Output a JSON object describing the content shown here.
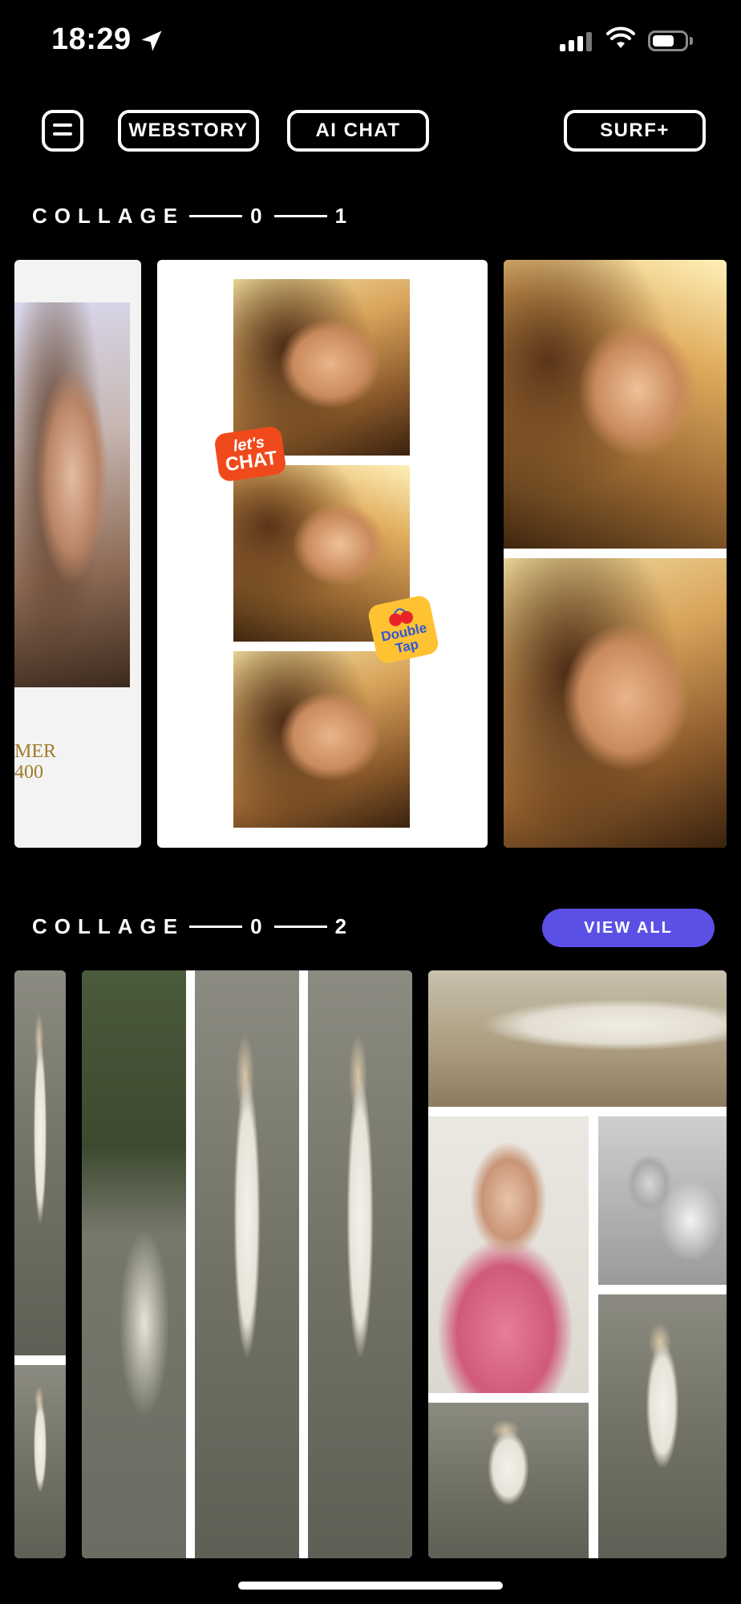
{
  "status_bar": {
    "time": "18:29"
  },
  "nav": {
    "menu_icon": "menu-icon",
    "webstory": "WEBSTORY",
    "ai_chat": "AI CHAT",
    "surf": "SURF+"
  },
  "sections": [
    {
      "label": "COLLAGE",
      "n1": "0",
      "n2": "1"
    },
    {
      "label": "COLLAGE",
      "n1": "0",
      "n2": "2",
      "view_all": "VIEW ALL"
    }
  ],
  "stickers": {
    "lets_chat_top": "let's",
    "lets_chat_bottom": "CHAT",
    "double_tap": "Double Tap"
  },
  "poster_partial_text": {
    "line1": "MER",
    "line2": "400"
  },
  "colors": {
    "accent": "#5b50e6",
    "background": "#000000"
  }
}
